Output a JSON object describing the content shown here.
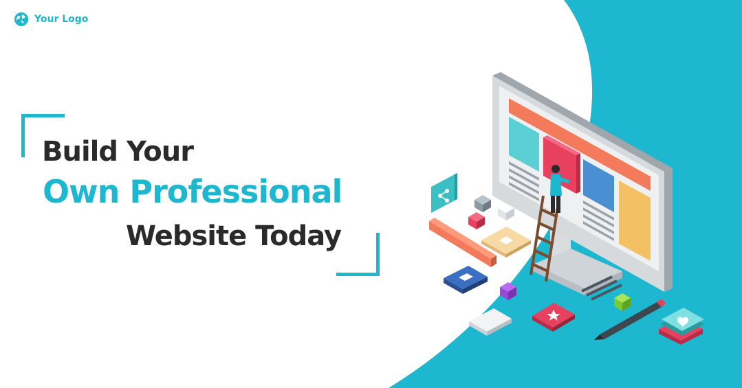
{
  "logo": {
    "text": "Your Logo",
    "icon": "globe-icon"
  },
  "headline": {
    "line1": "Build Your",
    "line2": "Own Professional",
    "line3": "Website Today"
  },
  "colors": {
    "accent": "#1db7cf",
    "dark_text": "#2a2a2a",
    "background": "#ffffff"
  },
  "illustration": {
    "icons": [
      "monitor-icon",
      "share-icon",
      "mail-icon",
      "chat-icon",
      "star-icon",
      "heart-icon",
      "ruler-icon",
      "pencil-icon",
      "ladder-icon"
    ]
  }
}
